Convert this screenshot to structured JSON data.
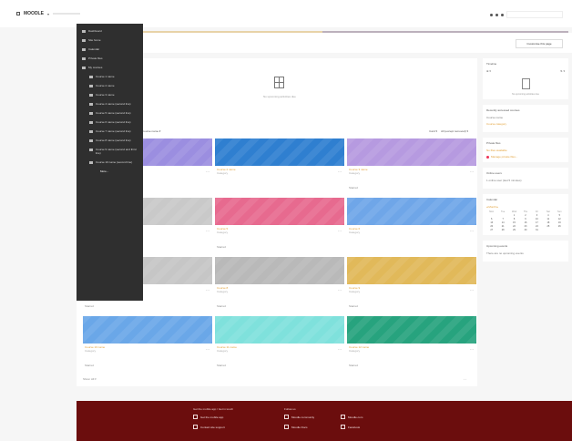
{
  "header": {
    "brand": "MOODLE",
    "brand_caret": "▾"
  },
  "page": {
    "primary_button": "Customise this page"
  },
  "sidebar": {
    "items": [
      {
        "label": "Dashboard",
        "icon": "dashboard-icon",
        "sub": false
      },
      {
        "label": "Site home",
        "icon": "home-icon",
        "sub": false
      },
      {
        "label": "Calendar",
        "icon": "calendar-icon",
        "sub": false
      },
      {
        "label": "Private files",
        "icon": "file-icon",
        "sub": false
      },
      {
        "label": "My courses",
        "icon": "graduation-icon",
        "sub": false
      },
      {
        "label": "Course 1 name",
        "icon": "course-icon",
        "sub": true
      },
      {
        "label": "Course 2 name",
        "icon": "course-icon",
        "sub": true
      },
      {
        "label": "Course 3 name",
        "icon": "course-icon",
        "sub": true
      },
      {
        "label": "Course 4 name (second line)",
        "icon": "course-icon",
        "sub": true
      },
      {
        "label": "Course 5 name (second line)",
        "icon": "course-icon",
        "sub": true
      },
      {
        "label": "Course 6 name (second line)",
        "icon": "course-icon",
        "sub": true
      },
      {
        "label": "Course 7 name (second line)",
        "icon": "course-icon",
        "sub": true
      },
      {
        "label": "Course 8 name (second line)",
        "icon": "course-icon",
        "sub": true
      },
      {
        "label": "Course 9 name (second and third line)",
        "icon": "course-icon",
        "sub": true
      },
      {
        "label": "Course 10 name (second line)",
        "icon": "course-icon",
        "sub": true
      }
    ],
    "more_label": "More..."
  },
  "main": {
    "empty_text": "No upcoming activities due",
    "course_overview": {
      "sort_label": "Course name ▾",
      "view_label": "Card ▾",
      "filter_label": "All (except removed) ▾"
    },
    "courses": [
      {
        "title": "Course 1 name",
        "category": "Category",
        "color": "#9b8ee0",
        "starred": ""
      },
      {
        "title": "Course 2 name",
        "category": "Category",
        "color": "#2f7fd0",
        "starred": ""
      },
      {
        "title": "Course 3 name",
        "category": "Category",
        "color": "#b69ae0",
        "starred": "Starred"
      },
      {
        "title": "Course 4",
        "category": "Category",
        "color": "#c9c9c9",
        "starred": ""
      },
      {
        "title": "Course 5",
        "category": "Category",
        "color": "#e76a8f",
        "starred": "Starred"
      },
      {
        "title": "Course 6",
        "category": "Category",
        "color": "#6fa6e8",
        "starred": ""
      },
      {
        "title": "Course 7",
        "category": "Category",
        "color": "#c6c6c6",
        "starred": "Starred"
      },
      {
        "title": "Course 8",
        "category": "Category",
        "color": "#b9b9b9",
        "starred": "Starred"
      },
      {
        "title": "Course 9",
        "category": "Category",
        "color": "#e1b95a",
        "starred": "Starred"
      },
      {
        "title": "Course 10 name",
        "category": "Category",
        "color": "#6aa7e8",
        "starred": "Starred"
      },
      {
        "title": "Course 11 name",
        "category": "Category",
        "color": "#7fe1dc",
        "starred": "Starred"
      },
      {
        "title": "Course 12 name",
        "category": "Category",
        "color": "#27a37e",
        "starred": "Starred"
      }
    ],
    "pagination": "Show: All ▾",
    "pager_arrows": "‹ ›"
  },
  "right": {
    "timeline_title": "Timeline",
    "timeline_empty": "No upcoming activities due",
    "timeline_control_left": "⊕ ▾",
    "timeline_control_right": "⇅ ▾",
    "recent_title": "Recently accessed courses",
    "recent_text": "Course name",
    "recent_link": "Course category",
    "private_title": "Private files",
    "private_link": "No files available",
    "private_warn": "Manage private files...",
    "online_title": "Online users",
    "online_text": "1 online user (last 5 minutes)",
    "calendar_title": "Calendar",
    "calendar_month": "◂ Month ▸",
    "calendar_days": [
      "Mon",
      "Tue",
      "Wed",
      "Thu",
      "Fri",
      "Sat",
      "Sun"
    ],
    "calendar_dates": [
      "",
      "",
      "1",
      "2",
      "3",
      "4",
      "5",
      "6",
      "7",
      "8",
      "9",
      "10",
      "11",
      "12",
      "13",
      "14",
      "15",
      "16",
      "17",
      "18",
      "19",
      "20",
      "21",
      "22",
      "23",
      "24",
      "25",
      "26",
      "27",
      "28",
      "29",
      "30",
      "31",
      "",
      ""
    ],
    "upcoming_title": "Upcoming events",
    "upcoming_text": "There are no upcoming events"
  },
  "footer": {
    "col1_head": "Get the mobile app / Get in touch",
    "col1_row1": "Get the mobile app",
    "col1_row2": "Contact site support",
    "col2_head": "Follow us",
    "col2_row1": "Moodle community",
    "col2_row2": "Moodle Docs",
    "col3_row1": "Moodle.com",
    "col3_row2": "Facebook"
  }
}
